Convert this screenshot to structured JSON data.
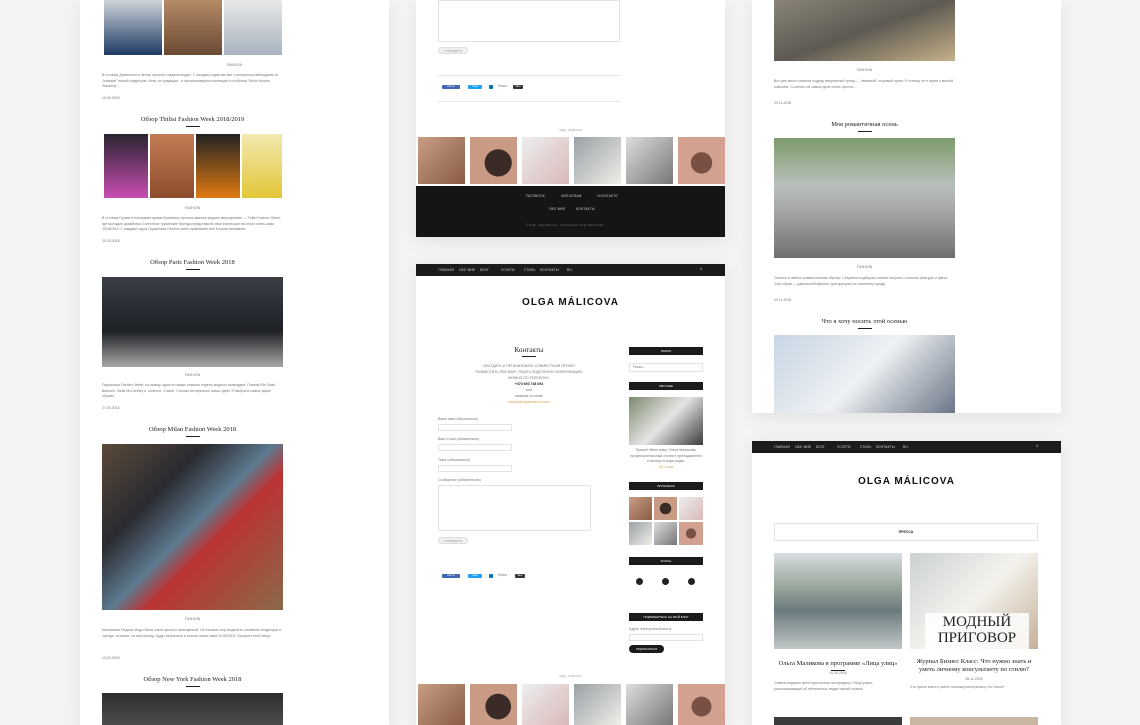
{
  "col1": {
    "intro_text": "В столице Дании почти летом, прошла «неделя моды». С каждым годом мы все с интересом наблюдаем за \"новыми\" нашей индустрии. Итак, по традиции - я проанализирую коллекции и отобрала \"Kultur bureau Storaring\"...",
    "intro_date": "19.04.2018",
    "posts": [
      {
        "title": "Обзор Tbilisi Fashion Week 2018/2019",
        "date": "20.03.2018",
        "text": "В столице Грузии в последнее время буквально прошло важное модное мероприятие — Tbilisi Fashion Week, где молодые дизайнеры и местные грузинские бренды представили свои коллекции на сезон осень-зима 2018/2019. С каждым годом Грузинская Fashion week привлекает всё больше внимания."
      },
      {
        "title": "Обзор Paris Fashion Week 2018",
        "date": "27.03.2018",
        "text": "Парижская Fashion Week, по-моему, одна из самых главных недель модного календаря. Показы Elie Saab, Balmain, Stella McCartney и, конечно, Chanel. Столько интересных новых идей. Я выбрала самые яркие образы."
      },
      {
        "title": "Обзор Milan Fashion Week 2018",
        "date": "13.03.2018",
        "text": "Миланская Неделя Моды была очень яркой и насыщенной. Из показов хочу выделить основные тенденции и тренды, которые, на мой взгляд, будут актуальны в сезоне осень-зима 2018/2019. Смотрите мой обзор."
      },
      {
        "title": "Обзор New York Fashion Week 2018"
      }
    ],
    "caption_small": "FASHION"
  },
  "col2": {
    "comment_button": "ОТПРАВИТЬ",
    "share_like": "Like 14",
    "share_tweet": "Tweet",
    "share_g": "Share",
    "share_save": "Save",
    "instagram_label": "olga_malicova",
    "footer": {
      "links": [
        "FACEBOOK",
        "INSTAGRAM",
        "VKONTAKTE"
      ],
      "links2": [
        "ОБО МНЕ",
        "КОНТАКТЫ"
      ],
      "copyright": "© 2018 · Olga Malicova · Developed by Smart Web Studio"
    },
    "nav": [
      "ГЛАВНАЯ",
      "ОБО МНЕ",
      "БЛОГ",
      "УСЛУГИ",
      "СТИЛЬ",
      "КОНТАКТЫ",
      "RU"
    ],
    "brand": "OLGA MÁLICOVA",
    "contacts": {
      "title": "Контакты",
      "lines": [
        "ОБСУДИТЬ И ОРГАНИЗОВАТЬ СОВМЕСТНЫЙ ПРОЕКТ",
        "РАЗМЕСТИТЬ РЕКЛАМУ, УЗНАТЬ ПОДРОБНУЮ ИНФОРМАЦИЮ",
        "МОЖНО ПО ТЕЛЕФОНУ:"
      ],
      "phone": "+373 693 748 094",
      "or": "или",
      "email_prompt": "написав на email:",
      "email": "contact@olgamalicova.com",
      "fields": [
        "Ваше имя (обязательно)",
        "Ваш e-mail (обязательно)",
        "Тема (обязательно)",
        "Сообщение (обязательно)"
      ],
      "submit": "ОТПРАВИТЬ"
    },
    "sidebar": {
      "search": "ПОИСК",
      "search_placeholder": "Поиск...",
      "about": "ОБО МНЕ",
      "about_text": "Привет! Меня зовут Ольга Маликова, профессиональный стилист, преподаватель и эксперт в мире моды.",
      "about_more": "Об о мне",
      "instagram": "INSTAGRAM",
      "social": "SOCIAL",
      "subscribe": "ПОДПИШИТЕСЬ НА МОЙ БЛОГ",
      "subscribe_label": "Адрес электронной почты",
      "subscribe_button": "ПОДПИСАТЬСЯ"
    }
  },
  "col3": {
    "text1": "Вот уже много сезонов подряд популярный трэнд — \"змеиный\" тигровый принт. Я отношу этот принт к вечной классике. Сочетать на самом деле очень просто...",
    "date1": "29.11.2018",
    "post2_title": "Моя романтичная осень",
    "text2": "Осенью я люблю романтические образы. Стараюсь подбирать мягкие силуэты, сочетать фактуры и цвета. Этот образ — идеальный вариант для прогулок по осеннему городу.",
    "date2": "20.11.2018",
    "post3_title": "Что я хочу носить этой осенью",
    "brand": "OLGA MÁLICOVA",
    "nav": [
      "ГЛАВНАЯ",
      "ОБО МНЕ",
      "БЛОГ",
      "УСЛУГИ",
      "СТИЛЬ",
      "КОНТАКТЫ",
      "RU"
    ],
    "press": "ПРЕССА",
    "press_items": [
      {
        "title": "Ольга Маликова в программе «Лица улиц»",
        "date": "14.09.2018",
        "text": "Совсем недавно меня пригласили на передачу «Лица улиц», рассказывающий об интересных людях нашей страны."
      },
      {
        "title": "Журнал Бизнес Класс: Что нужно знать и уметь личному консультанту по стилю?",
        "date": "28.11.2018",
        "text": "Что нужно знать и уметь личному консультанту по стилю?"
      }
    ],
    "overlay": "МОДНЫЙ ПРИГОВОР"
  }
}
